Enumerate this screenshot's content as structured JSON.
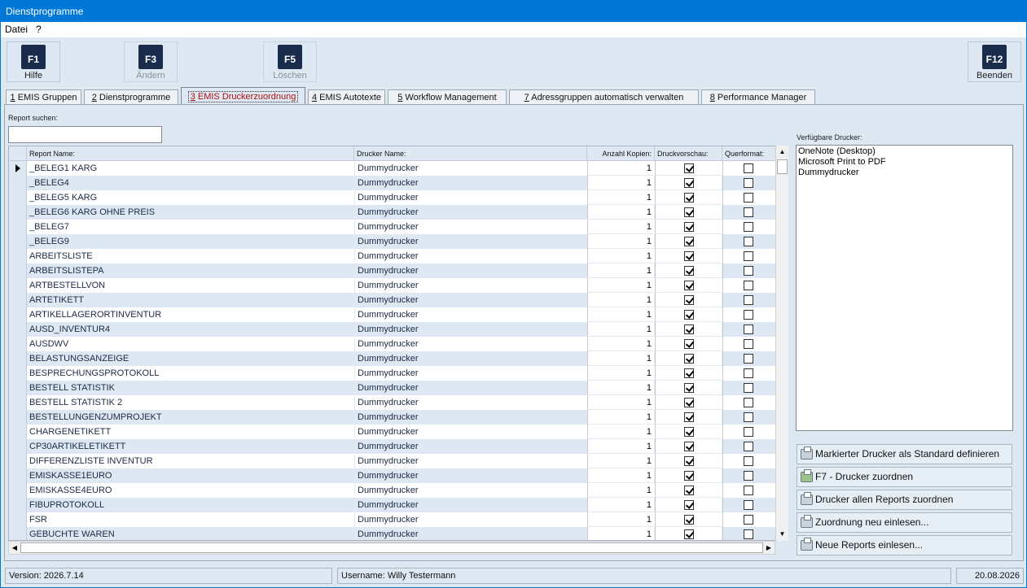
{
  "window": {
    "title": "Dienstprogramme"
  },
  "menu": [
    "Datei",
    "?"
  ],
  "toolbar": {
    "f1": {
      "key": "F1",
      "label": "Hilfe"
    },
    "f3": {
      "key": "F3",
      "label": "Ändern"
    },
    "f5": {
      "key": "F5",
      "label": "Löschen"
    },
    "f12": {
      "key": "F12",
      "label": "Beenden"
    }
  },
  "tabs": [
    {
      "num": "1",
      "label": " EMIS Gruppen"
    },
    {
      "num": "2",
      "label": " Dienstprogramme"
    },
    {
      "num": "3",
      "label": " EMIS Druckerzuordnung"
    },
    {
      "num": "4",
      "label": " EMIS Autotexte"
    },
    {
      "num": "5",
      "label": " Workflow Management"
    },
    {
      "num": "7",
      "label": " Adressgruppen automatisch verwalten"
    },
    {
      "num": "8",
      "label": " Performance Manager"
    }
  ],
  "search": {
    "label": "Report suchen:",
    "value": ""
  },
  "grid": {
    "headers": {
      "name": "Report Name:",
      "printer": "Drucker Name:",
      "copies": "Anzahl Kopien:",
      "preview": "Druckvorschau:",
      "landscape": "Querformat:"
    },
    "rows": [
      {
        "name": "_BELEG1   KARG",
        "printer": "Dummydrucker",
        "copies": "1",
        "preview": true,
        "landscape": false
      },
      {
        "name": "_BELEG4",
        "printer": "Dummydrucker",
        "copies": "1",
        "preview": true,
        "landscape": false
      },
      {
        "name": "_BELEG5  KARG",
        "printer": "Dummydrucker",
        "copies": "1",
        "preview": true,
        "landscape": false
      },
      {
        "name": "_BELEG6 KARG OHNE PREIS",
        "printer": "Dummydrucker",
        "copies": "1",
        "preview": true,
        "landscape": false
      },
      {
        "name": "_BELEG7",
        "printer": "Dummydrucker",
        "copies": "1",
        "preview": true,
        "landscape": false
      },
      {
        "name": "_BELEG9",
        "printer": "Dummydrucker",
        "copies": "1",
        "preview": true,
        "landscape": false
      },
      {
        "name": "ARBEITSLISTE",
        "printer": "Dummydrucker",
        "copies": "1",
        "preview": true,
        "landscape": false
      },
      {
        "name": "ARBEITSLISTEPA",
        "printer": "Dummydrucker",
        "copies": "1",
        "preview": true,
        "landscape": false
      },
      {
        "name": "ARTBESTELLVON",
        "printer": "Dummydrucker",
        "copies": "1",
        "preview": true,
        "landscape": false
      },
      {
        "name": "ARTETIKETT",
        "printer": "Dummydrucker",
        "copies": "1",
        "preview": true,
        "landscape": false
      },
      {
        "name": "ARTIKELLAGERORTINVENTUR",
        "printer": "Dummydrucker",
        "copies": "1",
        "preview": true,
        "landscape": false
      },
      {
        "name": "AUSD_INVENTUR4",
        "printer": "Dummydrucker",
        "copies": "1",
        "preview": true,
        "landscape": false
      },
      {
        "name": "AUSDWV",
        "printer": "Dummydrucker",
        "copies": "1",
        "preview": true,
        "landscape": false
      },
      {
        "name": "BELASTUNGSANZEIGE",
        "printer": "Dummydrucker",
        "copies": "1",
        "preview": true,
        "landscape": false
      },
      {
        "name": "BESPRECHUNGSPROTOKOLL",
        "printer": "Dummydrucker",
        "copies": "1",
        "preview": true,
        "landscape": false
      },
      {
        "name": "BESTELL STATISTIK",
        "printer": "Dummydrucker",
        "copies": "1",
        "preview": true,
        "landscape": false
      },
      {
        "name": "BESTELL STATISTIK 2",
        "printer": "Dummydrucker",
        "copies": "1",
        "preview": true,
        "landscape": false
      },
      {
        "name": "BESTELLUNGENZUMPROJEKT",
        "printer": "Dummydrucker",
        "copies": "1",
        "preview": true,
        "landscape": false
      },
      {
        "name": "CHARGENETIKETT",
        "printer": "Dummydrucker",
        "copies": "1",
        "preview": true,
        "landscape": false
      },
      {
        "name": "CP30ARTIKELETIKETT",
        "printer": "Dummydrucker",
        "copies": "1",
        "preview": true,
        "landscape": false
      },
      {
        "name": "DIFFERENZLISTE INVENTUR",
        "printer": "Dummydrucker",
        "copies": "1",
        "preview": true,
        "landscape": false
      },
      {
        "name": "EMISKASSE1EURO",
        "printer": "Dummydrucker",
        "copies": "1",
        "preview": true,
        "landscape": false
      },
      {
        "name": "EMISKASSE4EURO",
        "printer": "Dummydrucker",
        "copies": "1",
        "preview": true,
        "landscape": false
      },
      {
        "name": "FIBUPROTOKOLL",
        "printer": "Dummydrucker",
        "copies": "1",
        "preview": true,
        "landscape": false
      },
      {
        "name": "FSR",
        "printer": "Dummydrucker",
        "copies": "1",
        "preview": true,
        "landscape": false
      },
      {
        "name": "GEBUCHTE WAREN",
        "printer": "Dummydrucker",
        "copies": "1",
        "preview": true,
        "landscape": false
      }
    ]
  },
  "printers": {
    "label": "Verfügbare Drucker:",
    "items": [
      "OneNote (Desktop)",
      "Microsoft Print to PDF",
      "Dummydrucker"
    ]
  },
  "actions": [
    {
      "label": "Markierter Drucker als Standard definieren",
      "icon": "printer-icon"
    },
    {
      "label": "F7 - Drucker zuordnen",
      "icon": "printer-assign-icon"
    },
    {
      "label": "Drucker allen Reports zuordnen",
      "icon": "printer-icon"
    },
    {
      "label": "Zuordnung neu einlesen...",
      "icon": "printer-reload-icon"
    },
    {
      "label": "Neue Reports einlesen...",
      "icon": "printer-reload-icon"
    }
  ],
  "status": {
    "version": "Version: 2026.7.14",
    "user": "Username: Willy Testermann",
    "date": "20.08.2026"
  }
}
